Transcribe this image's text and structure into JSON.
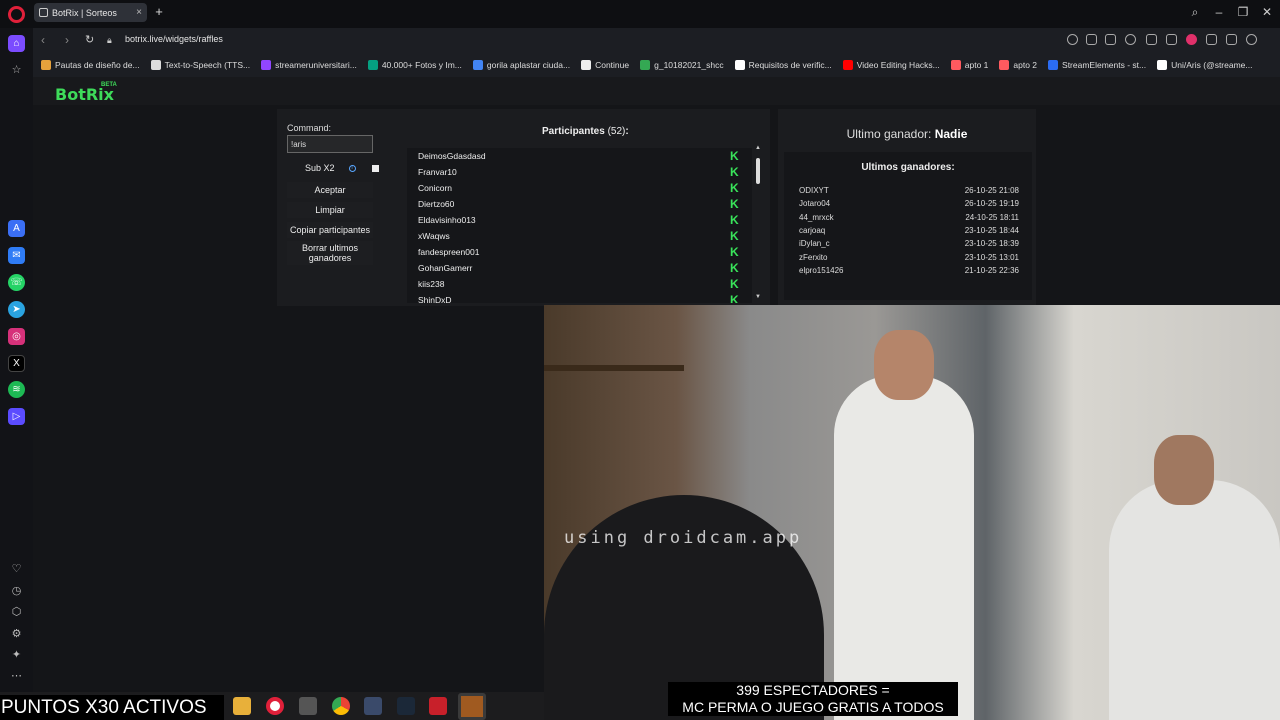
{
  "browser": {
    "tab_title": "BotRix | Sorteos",
    "url": "botrix.live/widgets/raffles",
    "bookmarks": [
      {
        "label": "Pautas de diseño de...",
        "icon": "bookmark-icon",
        "color": "#e6a23c"
      },
      {
        "label": "Text-to-Speech (TTS...",
        "icon": "tts-icon",
        "color": "#dddddd"
      },
      {
        "label": "streameruniversitari...",
        "icon": "twitch-icon",
        "color": "#9146ff"
      },
      {
        "label": "40.000+ Fotos y Im...",
        "icon": "pexels-icon",
        "color": "#05a081"
      },
      {
        "label": "gorila aplastar ciuda...",
        "icon": "google-icon",
        "color": "#4285f4"
      },
      {
        "label": "Continue",
        "icon": "doc-icon",
        "color": "#eeeeee"
      },
      {
        "label": "g_10182021_shcc",
        "icon": "drive-icon",
        "color": "#34a853"
      },
      {
        "label": "Requisitos de verific...",
        "icon": "x-icon",
        "color": "#ffffff"
      },
      {
        "label": "Video Editing Hacks...",
        "icon": "youtube-icon",
        "color": "#ff0000"
      },
      {
        "label": "apto 1",
        "icon": "airbnb-icon",
        "color": "#ff5a5f"
      },
      {
        "label": "apto 2",
        "icon": "airbnb-icon",
        "color": "#ff5a5f"
      },
      {
        "label": "StreamElements - st...",
        "icon": "streamelements-icon",
        "color": "#2b6cf3"
      },
      {
        "label": "Uni/Aris (@streame...",
        "icon": "tiktok-icon",
        "color": "#ffffff"
      }
    ]
  },
  "app": {
    "logo": "BotRix",
    "badge": "BETA",
    "command_label": "Command:",
    "command_value": "!aris",
    "sub_label": "Sub X2",
    "sub_info": "i",
    "buttons": {
      "accept": "Aceptar",
      "clear": "Limpiar",
      "copy": "Copiar participantes",
      "delete_winners": "Borrar ultimos ganadores"
    },
    "participants_title": "Participantes",
    "participants_count": "(52)",
    "participants_colon": ":",
    "participants": [
      "DeimosGdasdasd",
      "Franvar10",
      "Conicorn",
      "Diertzo60",
      "Eldavisinho013",
      "xWaqws",
      "fandespreen001",
      "GohanGamerr",
      "kiis238",
      "ShinDxD"
    ],
    "participant_platform_icon": "kick-icon",
    "last_winner_label": "Ultimo ganador:",
    "last_winner_name": "Nadie",
    "winners_title": "Ultimos ganadores:",
    "winners": [
      {
        "name": "ODIXYT",
        "date": "26-10-25 21:08"
      },
      {
        "name": "Jotaro04",
        "date": "26-10-25 19:19"
      },
      {
        "name": "44_mrxck",
        "date": "24-10-25 18:11"
      },
      {
        "name": "carjoaq",
        "date": "23-10-25 18:44"
      },
      {
        "name": "iDylan_c",
        "date": "23-10-25 18:39"
      },
      {
        "name": "zFerxito",
        "date": "23-10-25 13:01"
      },
      {
        "name": "elpro151426",
        "date": "21-10-25 22:36"
      }
    ]
  },
  "overlay": {
    "cam_watermark": "using droidcam.app",
    "caption_line1": "399 ESPECTADORES =",
    "caption_line2": "MC PERMA O JUEGO GRATIS A TODOS",
    "banner": "PUNTOS X30 ACTIVOS"
  },
  "colors": {
    "accent": "#3edb5a",
    "kick": "#39e35a",
    "opera": "#e0203a"
  }
}
